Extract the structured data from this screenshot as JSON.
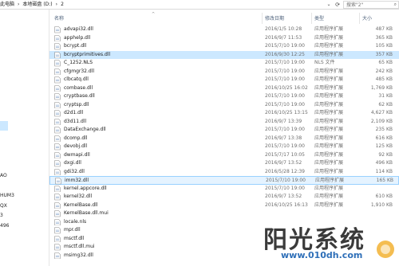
{
  "breadcrumb": {
    "items": [
      "此电脑",
      "本地磁盘 (D:)",
      "2"
    ],
    "separator": "›"
  },
  "address": {
    "dropdown_icon": "chevron-down-icon",
    "refresh_icon": "refresh-icon"
  },
  "search": {
    "placeholder": "搜索\"2\"",
    "icon": "search-icon"
  },
  "nav": {
    "items": [
      "AO",
      "HUM3",
      "QX",
      "3",
      "496"
    ]
  },
  "columns": {
    "name": "名称",
    "date": "修改日期",
    "type": "类型",
    "size": "大小"
  },
  "files": [
    {
      "name": "advapi32.dll",
      "date": "2016/1/5 10:28",
      "type": "应用程序扩展",
      "size": "487 KB",
      "state": ""
    },
    {
      "name": "apphelp.dll",
      "date": "2016/9/7 11:53",
      "type": "应用程序扩展",
      "size": "365 KB",
      "state": ""
    },
    {
      "name": "bcrypt.dll",
      "date": "2015/7/10 19:00",
      "type": "应用程序扩展",
      "size": "105 KB",
      "state": ""
    },
    {
      "name": "bcryptprimitives.dll",
      "date": "2016/9/30 12:25",
      "type": "应用程序扩展",
      "size": "357 KB",
      "state": "selected"
    },
    {
      "name": "C_1252.NLS",
      "date": "2015/7/10 19:00",
      "type": "NLS 文件",
      "size": "65 KB",
      "state": ""
    },
    {
      "name": "cfgmgr32.dll",
      "date": "2015/7/10 19:00",
      "type": "应用程序扩展",
      "size": "242 KB",
      "state": ""
    },
    {
      "name": "clbcatq.dll",
      "date": "2015/7/10 19:00",
      "type": "应用程序扩展",
      "size": "485 KB",
      "state": ""
    },
    {
      "name": "combase.dll",
      "date": "2016/10/25 16:02",
      "type": "应用程序扩展",
      "size": "1,769 KB",
      "state": ""
    },
    {
      "name": "cryptbase.dll",
      "date": "2015/7/10 19:00",
      "type": "应用程序扩展",
      "size": "31 KB",
      "state": ""
    },
    {
      "name": "cryptsp.dll",
      "date": "2015/7/10 19:00",
      "type": "应用程序扩展",
      "size": "62 KB",
      "state": ""
    },
    {
      "name": "d2d1.dll",
      "date": "2016/10/25 13:15",
      "type": "应用程序扩展",
      "size": "4,627 KB",
      "state": ""
    },
    {
      "name": "d3d11.dll",
      "date": "2016/9/7 13:39",
      "type": "应用程序扩展",
      "size": "2,109 KB",
      "state": ""
    },
    {
      "name": "DataExchange.dll",
      "date": "2015/7/10 19:00",
      "type": "应用程序扩展",
      "size": "235 KB",
      "state": ""
    },
    {
      "name": "dcomp.dll",
      "date": "2016/9/7 13:38",
      "type": "应用程序扩展",
      "size": "616 KB",
      "state": ""
    },
    {
      "name": "devobj.dll",
      "date": "2015/7/10 19:00",
      "type": "应用程序扩展",
      "size": "125 KB",
      "state": ""
    },
    {
      "name": "dwmapi.dll",
      "date": "2015/7/17 10:05",
      "type": "应用程序扩展",
      "size": "92 KB",
      "state": ""
    },
    {
      "name": "dxgi.dll",
      "date": "2016/9/7 13:52",
      "type": "应用程序扩展",
      "size": "496 KB",
      "state": ""
    },
    {
      "name": "gdi32.dll",
      "date": "2016/5/28 12:39",
      "type": "应用程序扩展",
      "size": "114 KB",
      "state": ""
    },
    {
      "name": "imm32.dll",
      "date": "2015/7/10 19:00",
      "type": "应用程序扩展",
      "size": "165 KB",
      "state": "highlight"
    },
    {
      "name": "kernel.appcore.dll",
      "date": "2015/7/10 19:00",
      "type": "应用程序扩展",
      "size": "",
      "state": ""
    },
    {
      "name": "kernel32.dll",
      "date": "2016/9/7 13:52",
      "type": "应用程序扩展",
      "size": "610 KB",
      "state": ""
    },
    {
      "name": "KernelBase.dll",
      "date": "2016/10/25 16:13",
      "type": "应用程序扩展",
      "size": "1,910 KB",
      "state": ""
    },
    {
      "name": "KernelBase.dll.mui",
      "date": "",
      "type": "",
      "size": "",
      "state": ""
    },
    {
      "name": "locale.nls",
      "date": "",
      "type": "",
      "size": "",
      "state": ""
    },
    {
      "name": "mpr.dll",
      "date": "",
      "type": "",
      "size": "",
      "state": ""
    },
    {
      "name": "msctf.dll",
      "date": "",
      "type": "",
      "size": "",
      "state": ""
    },
    {
      "name": "msctf.dll.mui",
      "date": "",
      "type": "",
      "size": "",
      "state": ""
    },
    {
      "name": "msimg32.dll",
      "date": "",
      "type": "",
      "size": "",
      "state": ""
    }
  ],
  "watermark": {
    "title": "阳光系统",
    "url": "www.010dh.com"
  },
  "colors": {
    "selected": "#cce8ff",
    "header_text": "#4c607a",
    "watermark_url": "#2e6fb8"
  }
}
